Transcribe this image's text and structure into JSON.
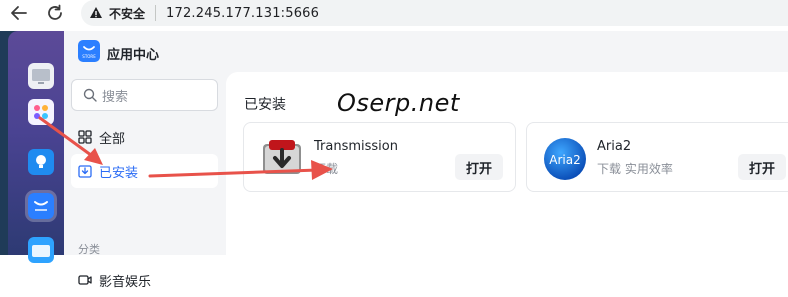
{
  "browser": {
    "insecure_label": "不安全",
    "url": "172.245.177.131:5666"
  },
  "app": {
    "title": "应用中心",
    "logo_text": "STORE"
  },
  "sidebar": {
    "search_placeholder": "搜索",
    "items": [
      {
        "label": "全部",
        "icon": "grid-icon"
      },
      {
        "label": "已安装",
        "icon": "install-icon",
        "selected": true
      }
    ],
    "section_label": "分类",
    "category_items": [
      {
        "label": "影音娱乐",
        "icon": "video-icon"
      }
    ]
  },
  "main": {
    "section_title": "已安装",
    "watermark": "Oserp.net",
    "apps": [
      {
        "name": "Transmission",
        "desc": "下载",
        "action": "打开",
        "icon": "transmission-icon"
      },
      {
        "name": "Aria2",
        "desc": "下载 实用效率",
        "action": "打开",
        "icon": "aria2-icon",
        "icon_text": "Aria2"
      }
    ]
  },
  "colors": {
    "accent": "#2b6cf5",
    "arrow": "#e8524a"
  }
}
